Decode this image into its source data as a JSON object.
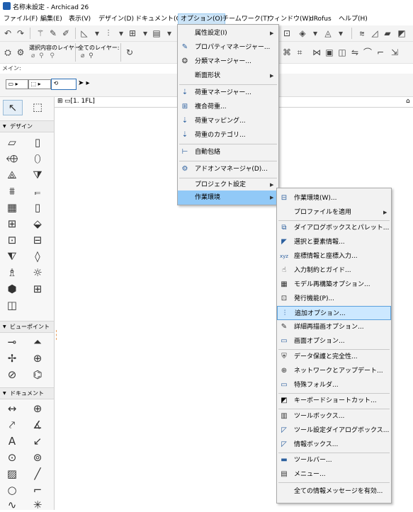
{
  "window": {
    "title": "名称未設定 - Archicad 26"
  },
  "menubar": {
    "items": [
      "ファイル(F)",
      "編集(E)",
      "表示(V)",
      "デザイン(D)",
      "ドキュメント(C)",
      "オプション(O)",
      "チームワーク(T)",
      "ウィンドウ(W)",
      "dRofus",
      "ヘルプ(H)"
    ]
  },
  "infobox": {
    "selection_label": "選択内容のレイヤー:",
    "all_layers_label": "全てのレイヤー:",
    "main_label": "メイン:"
  },
  "canvas": {
    "floor_tab": "[1. 1FL]"
  },
  "toolbox": {
    "groups": [
      "デザイン",
      "ビューポイント",
      "ドキュメント"
    ]
  },
  "options_menu": {
    "items": [
      {
        "label": "属性設定(I)",
        "icon": "none",
        "submenu": true
      },
      {
        "label": "プロパティマネージャー...",
        "icon": "property-icon",
        "submenu": false
      },
      {
        "label": "分類マネージャー...",
        "icon": "classification-icon",
        "submenu": false
      },
      {
        "label": "断面形状",
        "icon": "none",
        "submenu": true
      },
      {
        "label": "荷重マネージャー...",
        "icon": "load-manager-icon",
        "submenu": false
      },
      {
        "label": "複合荷重...",
        "icon": "load-combo-icon",
        "submenu": false
      },
      {
        "label": "荷重マッピング...",
        "icon": "load-mapping-icon",
        "submenu": false
      },
      {
        "label": "荷重のカテゴリ...",
        "icon": "load-category-icon",
        "submenu": false
      },
      {
        "label": "自動包絡",
        "icon": "auto-intersect-icon",
        "submenu": false
      },
      {
        "label": "アドオンマネージャ(D)...",
        "icon": "addon-icon",
        "submenu": false
      },
      {
        "label": "プロジェクト設定",
        "icon": "none",
        "submenu": true
      },
      {
        "label": "作業環境",
        "icon": "none",
        "submenu": true
      }
    ]
  },
  "work_env_submenu": {
    "items": [
      "作業環境(W)...",
      "プロファイルを適用",
      "ダイアログボックスとパレット...",
      "選択と要素情報...",
      "座標情報と座標入力...",
      "入力制約とガイド...",
      "モデル再構築オプション...",
      "発行機能(P)...",
      "追加オプション...",
      "詳細再描画オプション...",
      "画面オプション...",
      "データ保護と完全性...",
      "ネットワークとアップデート...",
      "特殊フォルダ...",
      "キーボードショートカット...",
      "ツールボックス...",
      "ツール設定ダイアログボックス...",
      "情報ボックス...",
      "ツールバー...",
      "メニュー...",
      "全ての情報メッセージを有効..."
    ]
  },
  "colors": {
    "accent": "#1f5fb0",
    "highlight": "#91c9f7",
    "hover": "#cce8ff"
  }
}
